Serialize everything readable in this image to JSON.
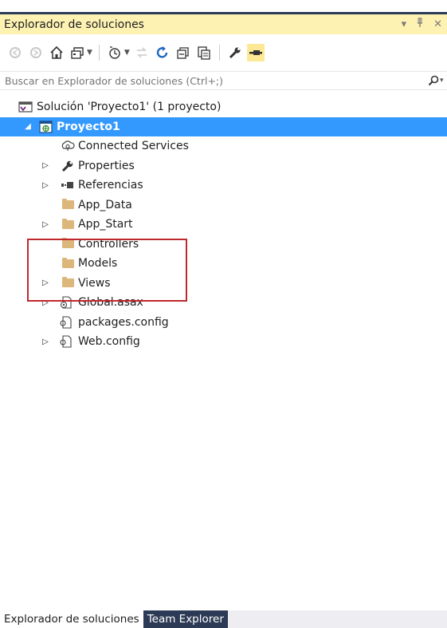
{
  "panel": {
    "title": "Explorador de soluciones",
    "dropdown_icon": "▾",
    "pin_icon": "pin-icon",
    "close_icon": "✕"
  },
  "toolbar": {
    "icons": [
      "back-icon",
      "forward-icon",
      "home-icon",
      "switch-views-icon",
      "pending-changes-filter-icon",
      "sync-icon",
      "refresh-icon",
      "collapse-all-icon",
      "show-all-files-icon",
      "properties-icon",
      "preview-icon"
    ]
  },
  "search": {
    "placeholder": "Buscar en Explorador de soluciones (Ctrl+;)",
    "value": ""
  },
  "tree": {
    "solution": "Solución 'Proyecto1'  (1 proyecto)",
    "project": "Proyecto1",
    "items": [
      {
        "label": "Connected Services",
        "icon": "connected-services-icon",
        "expandable": false
      },
      {
        "label": "Properties",
        "icon": "wrench-icon",
        "expandable": true
      },
      {
        "label": "Referencias",
        "icon": "references-icon",
        "expandable": true
      },
      {
        "label": "App_Data",
        "icon": "folder-icon",
        "expandable": false
      },
      {
        "label": "App_Start",
        "icon": "folder-icon",
        "expandable": true
      },
      {
        "label": "Controllers",
        "icon": "folder-icon",
        "expandable": false
      },
      {
        "label": "Models",
        "icon": "folder-icon",
        "expandable": false
      },
      {
        "label": "Views",
        "icon": "folder-icon",
        "expandable": true
      },
      {
        "label": "Global.asax",
        "icon": "asax-file-icon",
        "expandable": true
      },
      {
        "label": "packages.config",
        "icon": "config-file-icon",
        "expandable": false
      },
      {
        "label": "Web.config",
        "icon": "config-file-icon",
        "expandable": true
      }
    ]
  },
  "bottom_tabs": {
    "active": "Explorador de soluciones",
    "inactive": "Team Explorer"
  },
  "colors": {
    "title_bg": "#fef2b3",
    "selection": "#3399ff",
    "highlight_box": "#c0282d",
    "inactive_tab": "#2d3a55"
  }
}
